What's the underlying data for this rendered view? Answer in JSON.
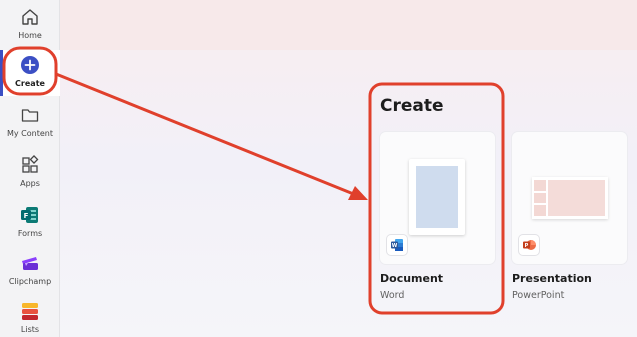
{
  "sidebar": {
    "items": [
      {
        "label": "Home",
        "icon": "home-icon"
      },
      {
        "label": "Create",
        "icon": "plus-circle-icon"
      },
      {
        "label": "My Content",
        "icon": "folder-icon"
      },
      {
        "label": "Apps",
        "icon": "apps-icon"
      },
      {
        "label": "Forms",
        "icon": "forms-app-icon"
      },
      {
        "label": "Clipchamp",
        "icon": "clipchamp-app-icon"
      },
      {
        "label": "Lists",
        "icon": "lists-app-icon"
      }
    ],
    "active_index": 1
  },
  "main": {
    "title": "Create",
    "cards": [
      {
        "name": "Document",
        "app": "Word",
        "badge_icon": "word-icon"
      },
      {
        "name": "Presentation",
        "app": "PowerPoint",
        "badge_icon": "powerpoint-icon"
      }
    ]
  },
  "colors": {
    "accent": "#3b4fc4",
    "annotation_red": "#e0402c",
    "word_blue": "#2b579a",
    "powerpoint_orange": "#c43e1c"
  }
}
